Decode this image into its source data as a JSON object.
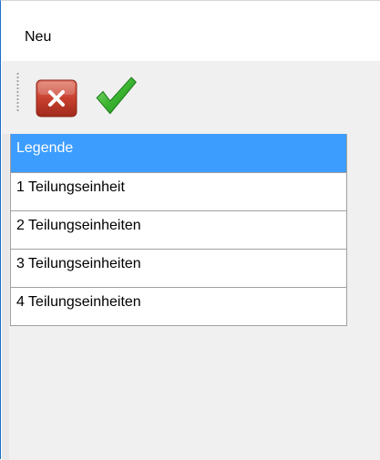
{
  "window": {
    "title": "Neu"
  },
  "toolbar": {
    "cancel_icon": "close-icon",
    "confirm_icon": "checkmark-icon",
    "cancel_color": "#c0392b",
    "confirm_color": "#3cb531"
  },
  "grid": {
    "header": "Legende",
    "header_color": "#3d9dff",
    "rows": [
      "1 Teilungseinheit",
      "2 Teilungseinheiten",
      "3 Teilungseinheiten",
      "4 Teilungseinheiten"
    ]
  }
}
